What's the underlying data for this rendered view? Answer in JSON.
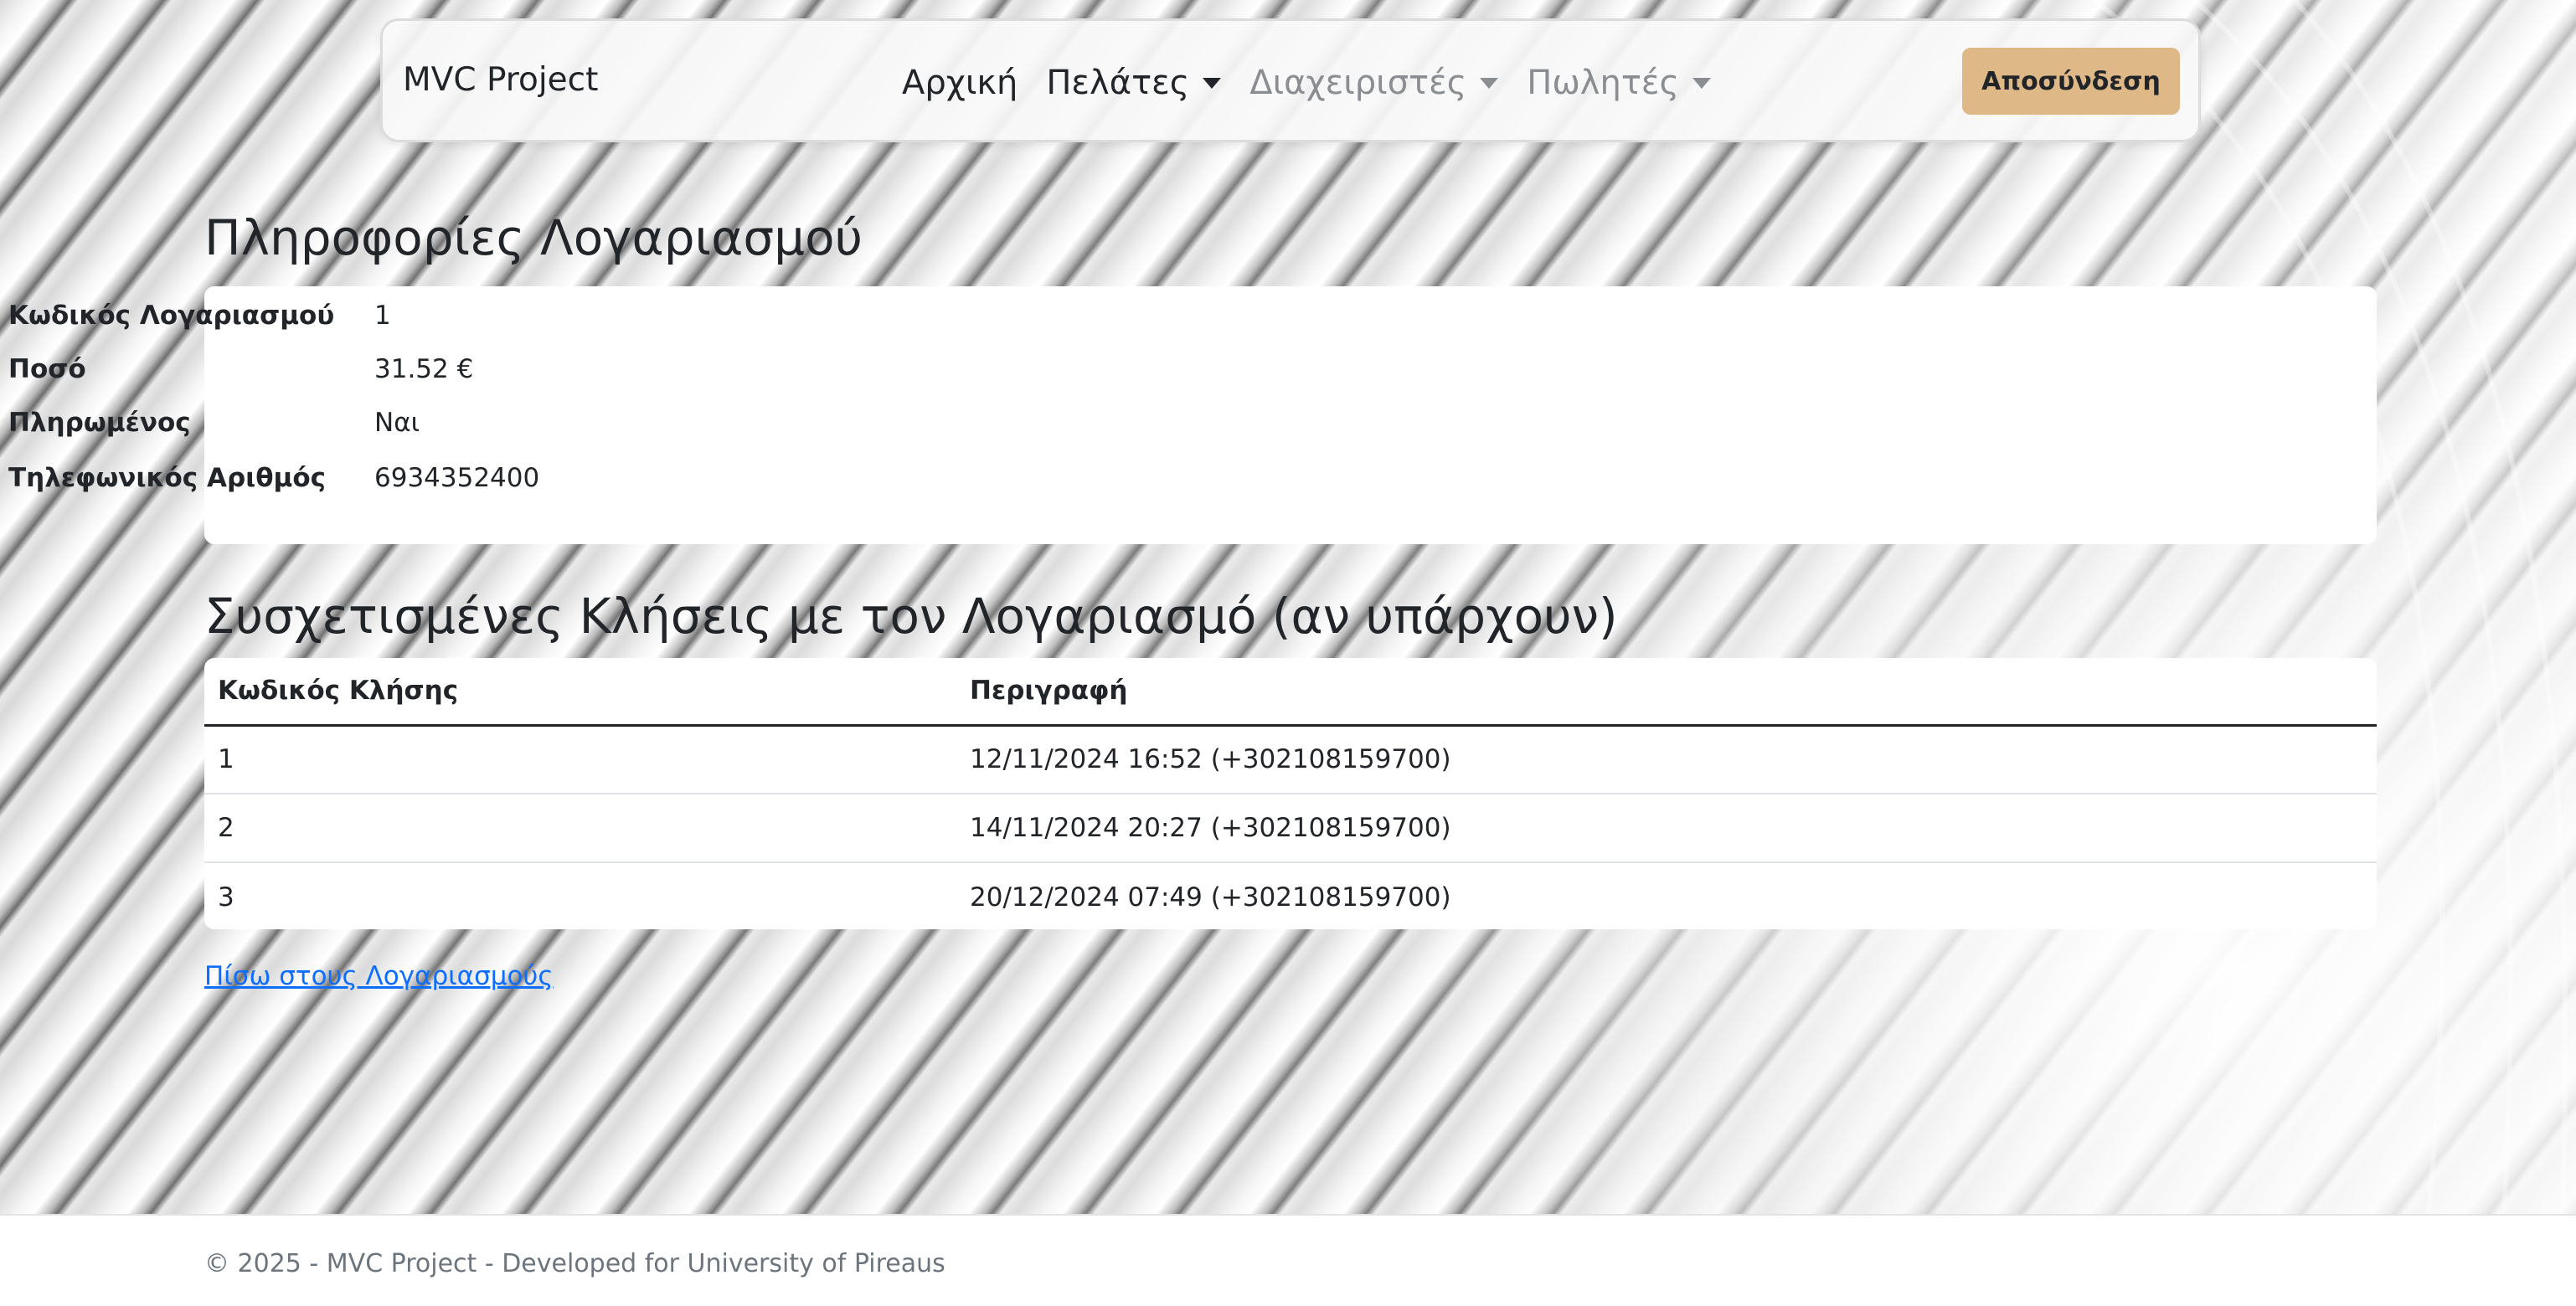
{
  "navbar": {
    "brand": "MVC Project",
    "items": [
      {
        "label": "Αρχική",
        "dropdown": false
      },
      {
        "label": "Πελάτες",
        "dropdown": true
      },
      {
        "label": "Διαχειριστές",
        "dropdown": true
      },
      {
        "label": "Πωλητές",
        "dropdown": true
      }
    ],
    "logout_label": "Αποσύνδεση"
  },
  "account": {
    "title": "Πληροφορίες Λογαριασμού",
    "fields": [
      {
        "label": "Κωδικός Λογαριασμού",
        "value": "1"
      },
      {
        "label": "Ποσό",
        "value": "31.52 €"
      },
      {
        "label": "Πληρωμένος",
        "value": "Ναι"
      },
      {
        "label": "Τηλεφωνικός Αριθμός",
        "value": "6934352400"
      }
    ]
  },
  "calls": {
    "title": "Συσχετισμένες Κλήσεις με τον Λογαριασμό (αν υπάρχουν)",
    "columns": [
      "Κωδικός Κλήσης",
      "Περιγραφή"
    ],
    "rows": [
      {
        "id": "1",
        "description": "12/11/2024 16:52 (+302108159700)"
      },
      {
        "id": "2",
        "description": "14/11/2024 20:27 (+302108159700)"
      },
      {
        "id": "3",
        "description": "20/12/2024 07:49 (+302108159700)"
      }
    ]
  },
  "back_link": "Πίσω στους Λογαριασμούς",
  "footer": {
    "text": "© 2025 - MVC Project - Developed for University of Pireaus"
  },
  "colors": {
    "logout_button": "#deb887",
    "link": "#0d6efd",
    "muted_nav": "#8a8d91"
  }
}
